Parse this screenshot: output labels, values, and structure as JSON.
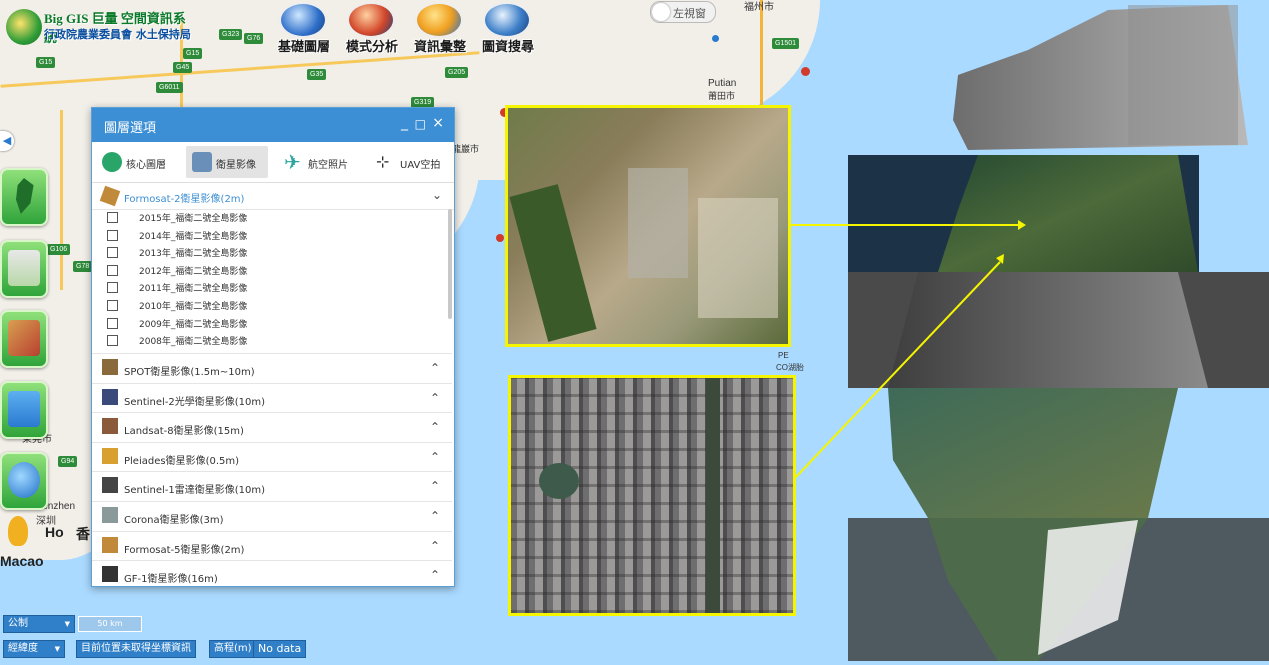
{
  "header": {
    "logo_line1": "Big GIS  巨量 空間資訊系統",
    "logo_line2": "行政院農業委員會 水土保持局",
    "nav": [
      "基礎圖層",
      "模式分析",
      "資訊彙整",
      "圖資搜尋"
    ],
    "toggle_label": "左視窗"
  },
  "map_labels": {
    "cities": [
      "福州市",
      "Putian",
      "莆田市",
      "龍巖市",
      "東莞市",
      "Shenzhen",
      "深圳",
      "Macao",
      "Ho",
      "香",
      "PE",
      "CO湖胎"
    ],
    "shields": [
      "G323",
      "G76",
      "G15",
      "G45",
      "G35",
      "G205",
      "G6011",
      "G319",
      "G106",
      "G78",
      "G94",
      "G1501",
      "G15"
    ]
  },
  "panel": {
    "title": "圖層選項",
    "controls": [
      "_",
      "□",
      "×"
    ],
    "tabs": [
      {
        "label": "核心圖層",
        "icon": "core-layer-icon",
        "active": false
      },
      {
        "label": "衛星影像",
        "icon": "satellite-icon",
        "active": true
      },
      {
        "label": "航空照片",
        "icon": "airplane-icon",
        "active": false
      },
      {
        "label": "UAV空拍",
        "icon": "drone-icon",
        "active": false
      }
    ],
    "open_group": "Formosat-2衛星影像(2m)",
    "items": [
      "2015年_福衛二號全島影像",
      "2014年_福衛二號全島影像",
      "2013年_福衛二號全島影像",
      "2012年_福衛二號全島影像",
      "2011年_福衛二號全島影像",
      "2010年_福衛二號全島影像",
      "2009年_福衛二號全島影像",
      "2008年_福衛二號全島影像"
    ],
    "groups": [
      "SPOT衛星影像(1.5m~10m)",
      "Sentinel-2光學衛星影像(10m)",
      "Landsat-8衛星影像(15m)",
      "Pleiades衛星影像(0.5m)",
      "Sentinel-1雷達衛星影像(10m)",
      "Corona衛星影像(3m)",
      "Formosat-5衛星影像(2m)",
      "GF-1衛星影像(16m)"
    ]
  },
  "bottom": {
    "unit_select": "公制",
    "scale": "50 km",
    "coord_select": "經緯度",
    "position_text": "目前位置未取得坐標資訊",
    "elevation_label": "高程(m)",
    "elevation_value": "No data"
  },
  "colors": {
    "accent": "#3c8fd4",
    "highlight": "#f5f500",
    "sidebtn": "#2fa43a"
  }
}
